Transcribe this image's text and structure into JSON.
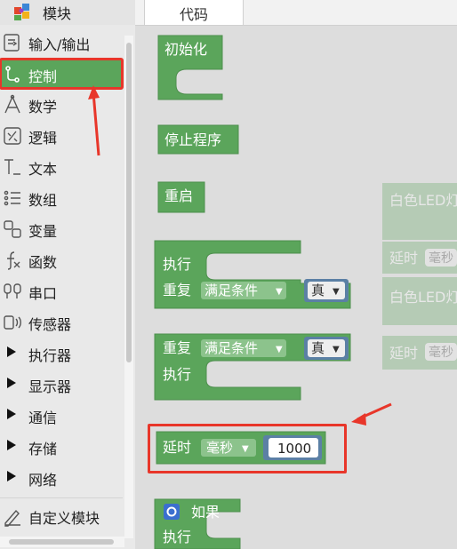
{
  "sidebar": {
    "title": "模块",
    "categories": [
      {
        "label": "输入/输出",
        "icon": "input-output-icon"
      },
      {
        "label": "控制",
        "icon": "control-icon"
      },
      {
        "label": "数学",
        "icon": "math-icon"
      },
      {
        "label": "逻辑",
        "icon": "logic-icon"
      },
      {
        "label": "文本",
        "icon": "text-icon"
      },
      {
        "label": "数组",
        "icon": "list-icon"
      },
      {
        "label": "变量",
        "icon": "variable-icon"
      },
      {
        "label": "函数",
        "icon": "function-icon"
      },
      {
        "label": "串口",
        "icon": "serial-icon"
      },
      {
        "label": "传感器",
        "icon": "sensor-icon"
      },
      {
        "label": "执行器"
      },
      {
        "label": "显示器"
      },
      {
        "label": "通信"
      },
      {
        "label": "存储"
      },
      {
        "label": "网络"
      },
      {
        "label": "自定义模块",
        "icon": "custom-module-icon"
      }
    ],
    "active_category": "控制"
  },
  "tabs": {
    "code": "代码"
  },
  "blocks": {
    "init": "初始化",
    "stop": "停止程序",
    "restart": "重启",
    "do_while": {
      "execute": "执行",
      "repeat": "重复",
      "mode": "满足条件",
      "cond": "真"
    },
    "while_do": {
      "repeat": "重复",
      "mode": "满足条件",
      "cond": "真",
      "execute": "执行"
    },
    "delay": {
      "label": "延时",
      "unit": "毫秒",
      "value": "1000"
    },
    "if_block": {
      "label": "如果",
      "execute": "执行"
    },
    "ghost": {
      "white_led_1": "白色LED灯",
      "delay_1": "延时",
      "unit_1": "毫秒",
      "white_led_2": "白色LED灯",
      "delay_2": "延时",
      "unit_2": "毫秒"
    }
  },
  "colors": {
    "block_green": "#5ba55b",
    "highlight_red": "#e8362a",
    "active_bg": "#5ba55b"
  }
}
